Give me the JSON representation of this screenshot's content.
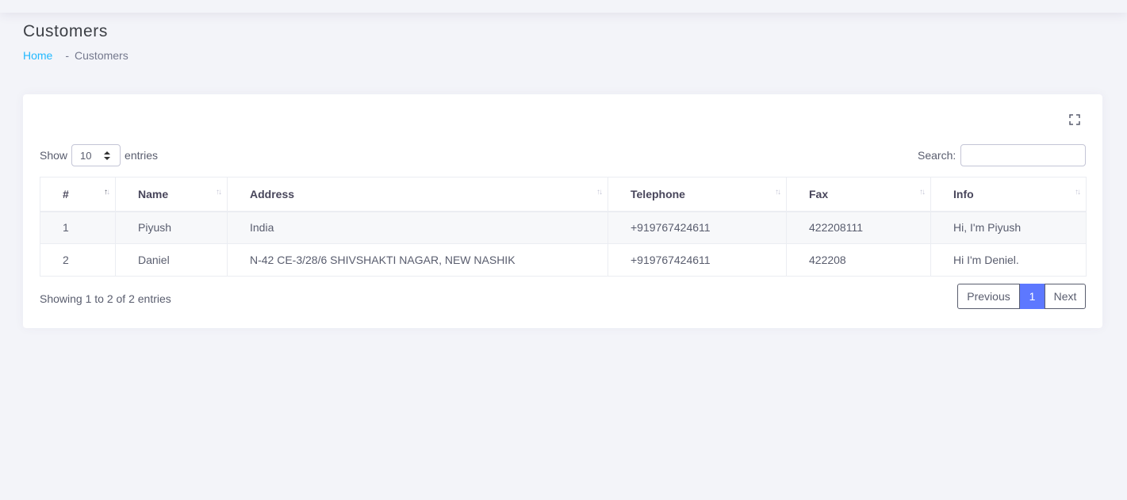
{
  "page": {
    "title": "Customers"
  },
  "breadcrumb": {
    "home": "Home",
    "separator": "-",
    "current": "Customers"
  },
  "length": {
    "prefix": "Show",
    "value": "10",
    "suffix": "entries"
  },
  "search": {
    "label": "Search:",
    "value": "",
    "placeholder": ""
  },
  "table": {
    "columns": [
      "#",
      "Name",
      "Address",
      "Telephone",
      "Fax",
      "Info"
    ],
    "sort": {
      "column": "#",
      "direction": "asc"
    },
    "rows": [
      [
        "1",
        "Piyush",
        "India",
        "+919767424611",
        "422208111",
        "Hi, I'm Piyush"
      ],
      [
        "2",
        "Daniel",
        "N-42 CE-3/28/6 SHIVSHAKTI NAGAR, NEW NASHIK",
        "+919767424611",
        "422208",
        "Hi I'm Deniel."
      ]
    ]
  },
  "info": "Showing 1 to 2 of 2 entries",
  "pagination": {
    "previous": "Previous",
    "current": "1",
    "next": "Next"
  },
  "colors": {
    "accent": "#5d78ff",
    "link": "#22b9ff",
    "background": "#f3f4f9"
  },
  "icons": {
    "fullscreen": "expand-icon",
    "sort": "sort-icon",
    "select": "select-arrows-icon"
  }
}
